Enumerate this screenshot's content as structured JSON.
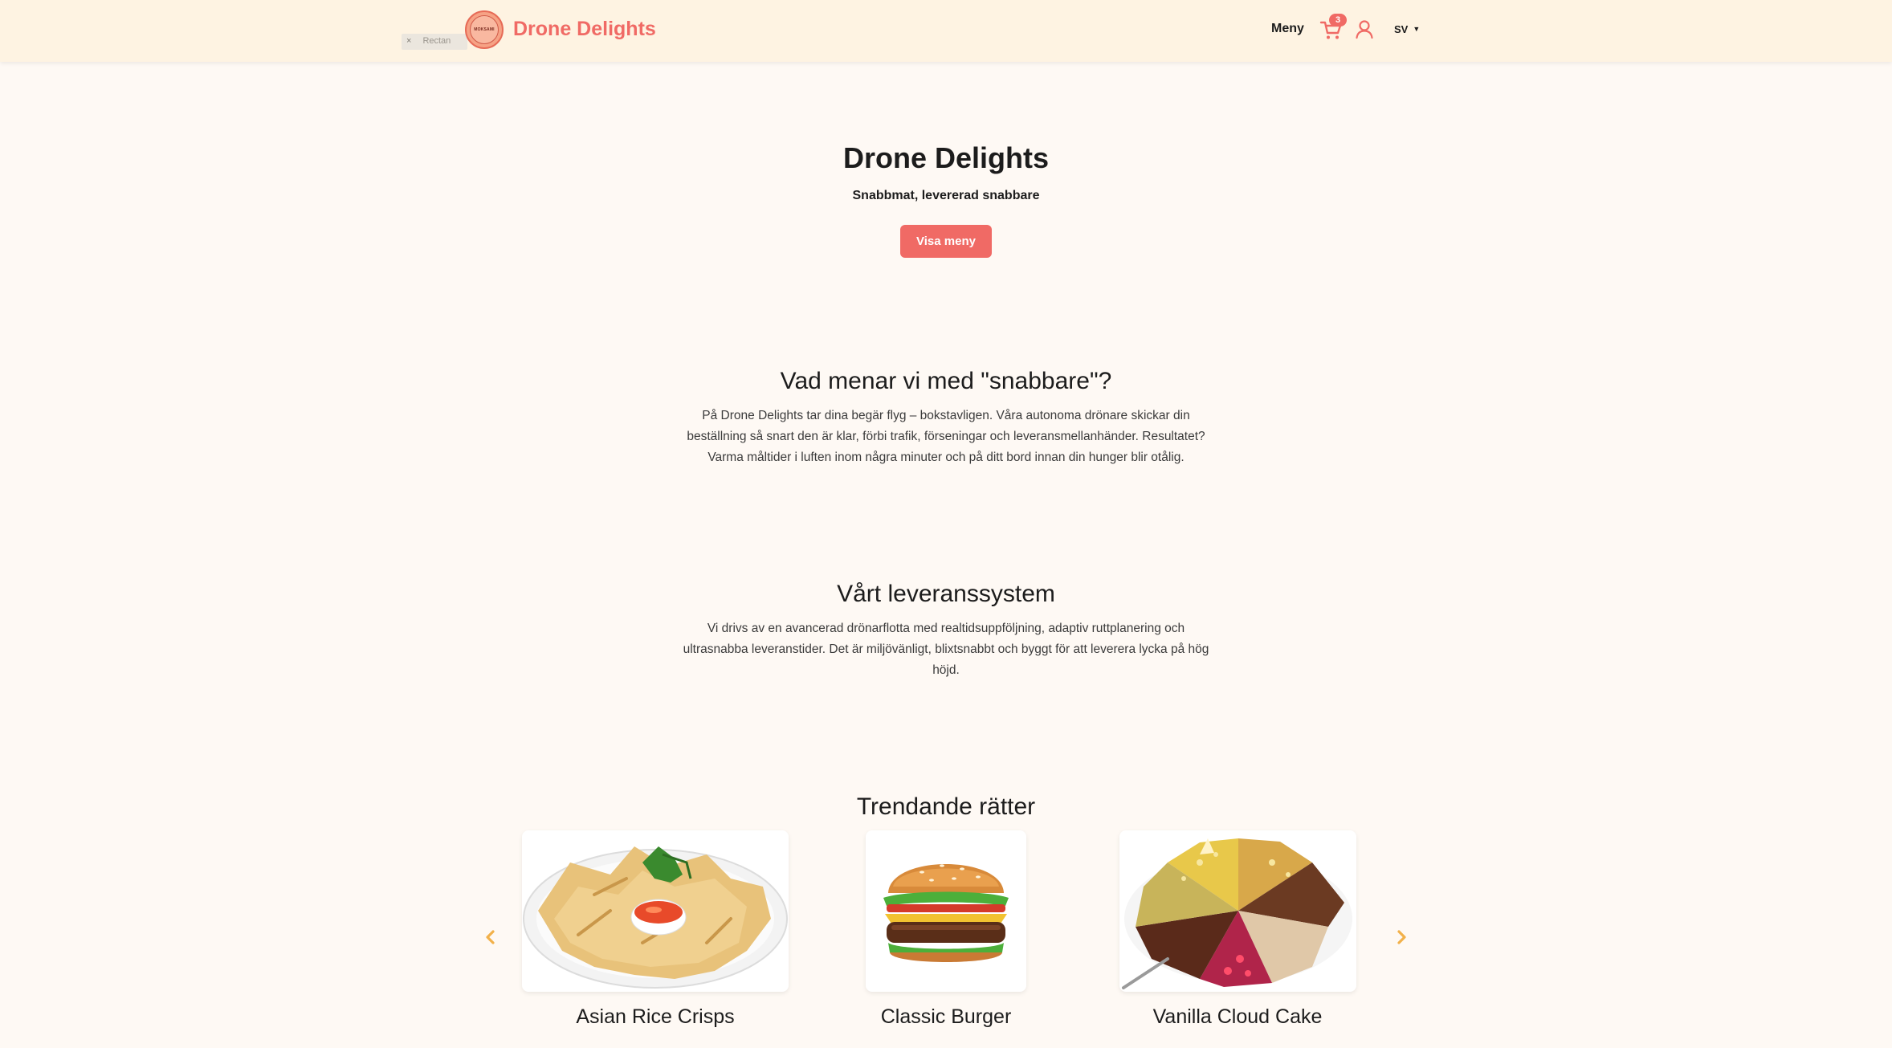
{
  "header": {
    "ghost_label": "Rectan",
    "logo_text": "MOKSAMI",
    "brand": "Drone Delights",
    "nav_menu": "Meny",
    "cart_count": "3",
    "language": "SV"
  },
  "hero": {
    "title": "Drone Delights",
    "subtitle": "Snabbmat, levererad snabbare",
    "cta": "Visa meny"
  },
  "faster": {
    "title": "Vad menar vi med \"snabbare\"?",
    "lines": [
      "På Drone Delights tar dina begär flyg – bokstavligen. Våra autonoma drönare skickar din",
      "beställning så snart den är klar, förbi trafik, förseningar och leveransmellanhänder. Resultatet?",
      "Varma måltider i luften inom några minuter och på ditt bord innan din hunger blir otålig."
    ]
  },
  "delivery": {
    "title": "Vårt leveranssystem",
    "lines": [
      "Vi drivs av en avancerad drönarflotta med realtidsuppföljning, adaptiv ruttplanering och",
      "ultrasnabba leveranstider. Det är miljövänligt, blixtsnabbt och byggt för att leverera lycka på hög",
      "höjd."
    ]
  },
  "trending": {
    "title": "Trendande rätter",
    "dishes": [
      {
        "name": "Asian Rice Crisps",
        "icon": "rice-crisps-image"
      },
      {
        "name": "Classic Burger",
        "icon": "burger-image"
      },
      {
        "name": "Vanilla Cloud Cake",
        "icon": "cake-image"
      }
    ]
  },
  "colors": {
    "accent": "#f06a65",
    "header_bg": "#fef3e2",
    "page_bg": "#fef9f4",
    "arrow": "#f2b14a"
  }
}
